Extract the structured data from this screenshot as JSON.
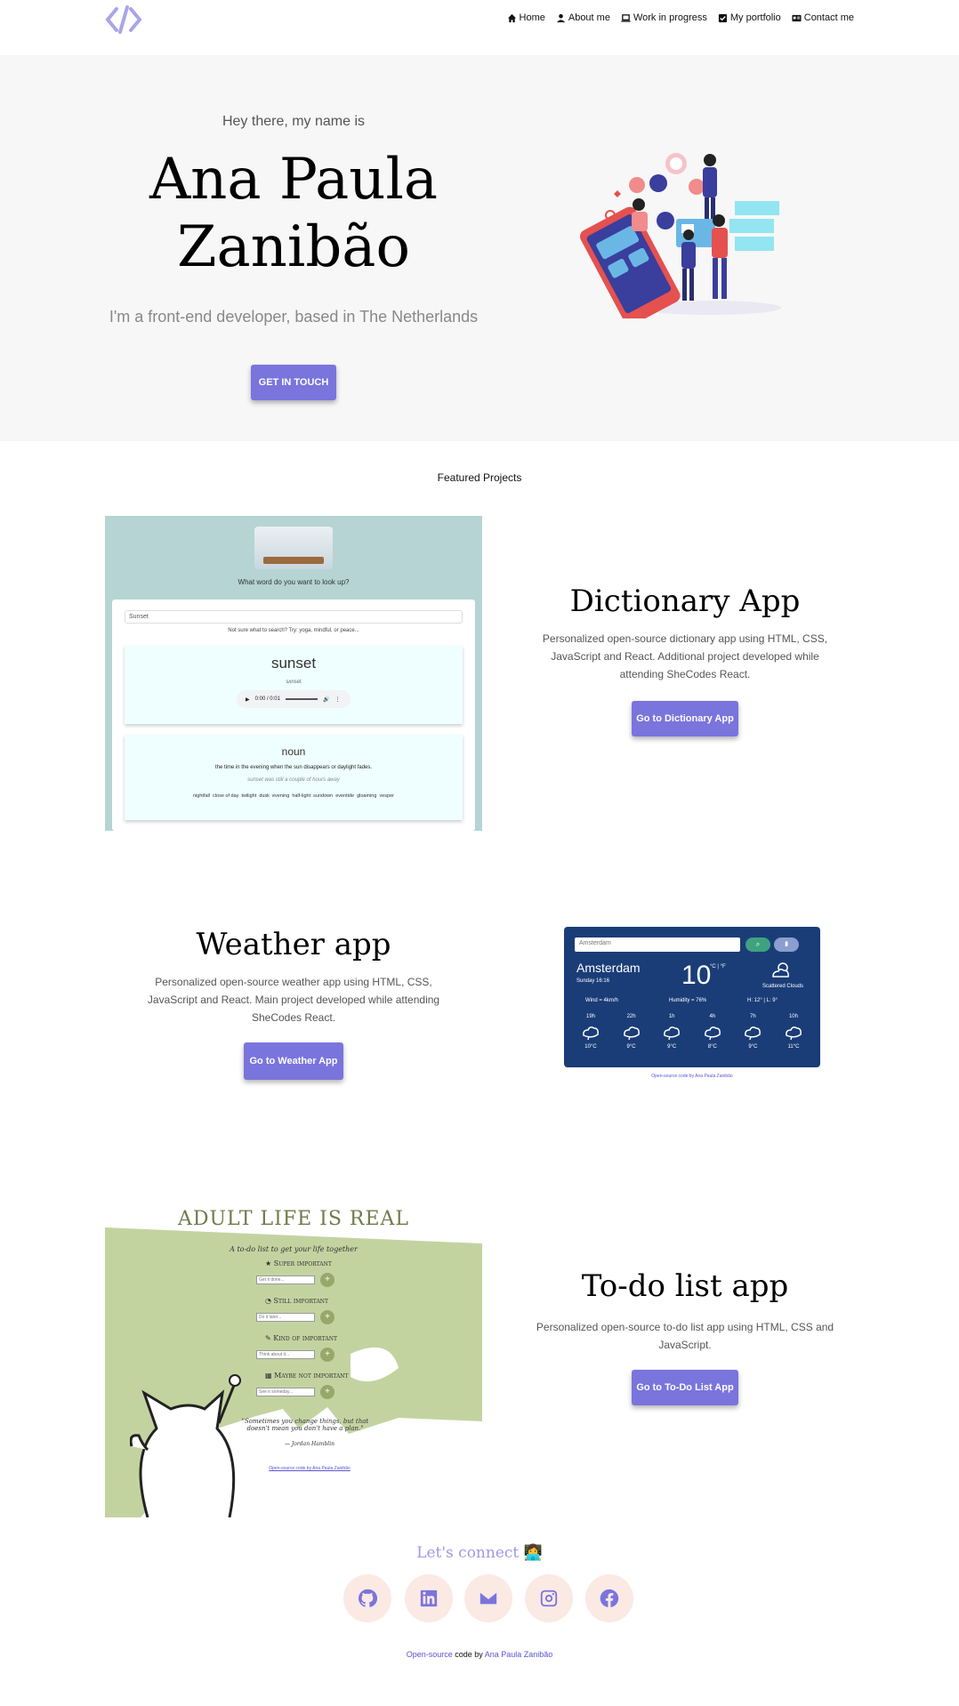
{
  "nav": {
    "items": [
      {
        "label": "Home",
        "icon": "home-icon"
      },
      {
        "label": "About me",
        "icon": "user-icon"
      },
      {
        "label": "Work in progress",
        "icon": "laptop-icon"
      },
      {
        "label": "My portfolio",
        "icon": "check-square-icon"
      },
      {
        "label": "Contact me",
        "icon": "id-card-icon"
      }
    ]
  },
  "hero": {
    "greeting": "Hey there, my name is",
    "name_line1": "Ana Paula",
    "name_line2": "Zanibão",
    "tagline": "I'm a front-end developer, based in The Netherlands",
    "cta": "GET IN TOUCH"
  },
  "featured": {
    "heading": "Featured Projects"
  },
  "projects": [
    {
      "title": "Dictionary App",
      "description": "Personalized open-source dictionary app using HTML, CSS, JavaScript and React. Additional project developed while attending SheCodes React.",
      "button": "Go to Dictionary App",
      "preview": {
        "prompt": "What word do you want to look up?",
        "search_value": "Sunset",
        "hint": "Not sure what to search? Try: yoga, mindful, or peace...",
        "word": "sunset",
        "phonetic": "sʌnset",
        "audio_time": "0:00 / 0:01",
        "part_of_speech": "noun",
        "definition": "the time in the evening when the sun disappears or daylight fades.",
        "example": "sunset was still a couple of hours away",
        "synonyms": "nightfall  close of day  twilight  dusk  evening  half-light  sundown  eventide  gloaming  vesper"
      }
    },
    {
      "title": "Weather app",
      "description": "Personalized open-source weather app using HTML, CSS, JavaScript and React. Main project developed while attending SheCodes React.",
      "button": "Go to Weather App",
      "preview": {
        "search_placeholder": "Amsterdam",
        "city": "Amsterdam",
        "date": "Sunday 16:16",
        "temp": "10",
        "units": "°C | °F",
        "condition": "Scattered Clouds",
        "wind": "Wind = 4km/h",
        "humidity": "Humidity = 76%",
        "hilo": "H: 12° | L: 9°",
        "hours": [
          "19h",
          "22h",
          "1h",
          "4h",
          "7h",
          "10h"
        ],
        "temps": [
          "10°C",
          "9°C",
          "9°C",
          "8°C",
          "9°C",
          "11°C"
        ],
        "credit": "Open-source code by Ana Paula Zanibão"
      }
    },
    {
      "title": "To-do list app",
      "description": "Personalized open-source to-do list app using HTML, CSS and JavaScript.",
      "button": "Go to To-Do List App",
      "preview": {
        "title": "ADULT LIFE IS REAL",
        "subtitle": "A to-do list to get your life together",
        "sections": [
          {
            "label": "Super important",
            "placeholder": "Get it done..."
          },
          {
            "label": "Still important",
            "placeholder": "Do it later..."
          },
          {
            "label": "Kind of important",
            "placeholder": "Think about it..."
          },
          {
            "label": "Maybe not important",
            "placeholder": "See it someday..."
          }
        ],
        "quote": "\"Sometimes you change things, but that doesn't mean you don't have a plan.\"",
        "author": "— Jordan Hamblin",
        "credit": "Open-source code by Ana Paula Zanibão"
      }
    }
  ],
  "connect": {
    "heading": "Let's connect 👩‍💻",
    "socials": [
      "github-icon",
      "linkedin-icon",
      "envelope-icon",
      "instagram-icon",
      "facebook-icon"
    ]
  },
  "footer": {
    "link1": "Open-source",
    "middle": " code by ",
    "link2": "Ana Paula Zanibão"
  },
  "colors": {
    "accent": "#7a74dd",
    "hero_bg": "#f7f7f8",
    "social_bg": "#fbe9e4",
    "todo_green": "#c3d3a0",
    "dict_bg": "#b5d4d3",
    "weather_bg": "#1a3d78"
  }
}
